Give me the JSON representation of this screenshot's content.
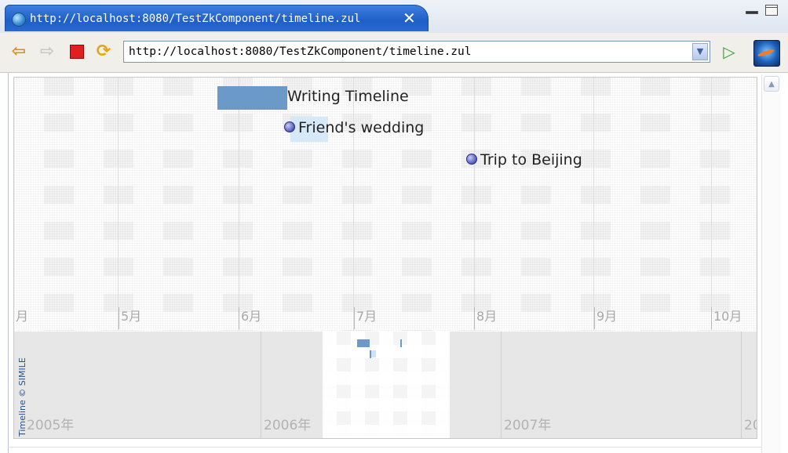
{
  "browser": {
    "tab_title": "http://localhost:8080/TestZkComponent/timeline.zul",
    "tab_close": "✕",
    "url": "http://localhost:8080/TestZkComponent/timeline.zul",
    "url_dropdown_icon": "▼"
  },
  "toolbar_icons": [
    "back-arrow-icon",
    "forward-arrow-icon",
    "stop-icon",
    "refresh-icon",
    "go-icon",
    "eclipse-logo-icon"
  ],
  "timeline": {
    "events": [
      {
        "label": "Writing Timeline",
        "type": "duration"
      },
      {
        "label": "Friend's wedding",
        "type": "instant"
      },
      {
        "label": "Trip to Beijing",
        "type": "instant"
      }
    ],
    "month_labels": [
      "月",
      "5月",
      "6月",
      "7月",
      "8月",
      "9月",
      "10月"
    ],
    "year_labels": [
      "2005年",
      "2006年",
      "2007年",
      "20"
    ],
    "credit": "Timeline © SIMILE"
  },
  "colors": {
    "tab_active": "#2a6ad0",
    "event_bar": "#6b9ac9",
    "event_dot": "#6268c8"
  }
}
